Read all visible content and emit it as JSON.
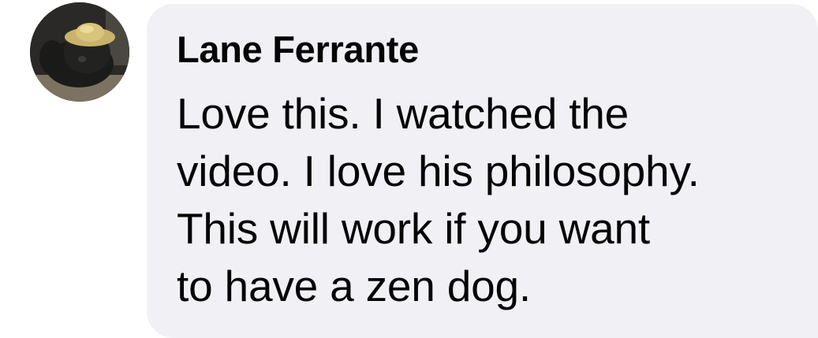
{
  "comment": {
    "author": "Lane Ferrante",
    "text_lines": [
      "Love this. I watched the",
      "video. I love his philosophy.",
      "This will work if you want",
      "to have a zen dog."
    ],
    "avatar_icon": "profile-photo-dog-with-straw-hat",
    "colors": {
      "bubble": "#f0f0f5",
      "text": "#050505"
    }
  }
}
